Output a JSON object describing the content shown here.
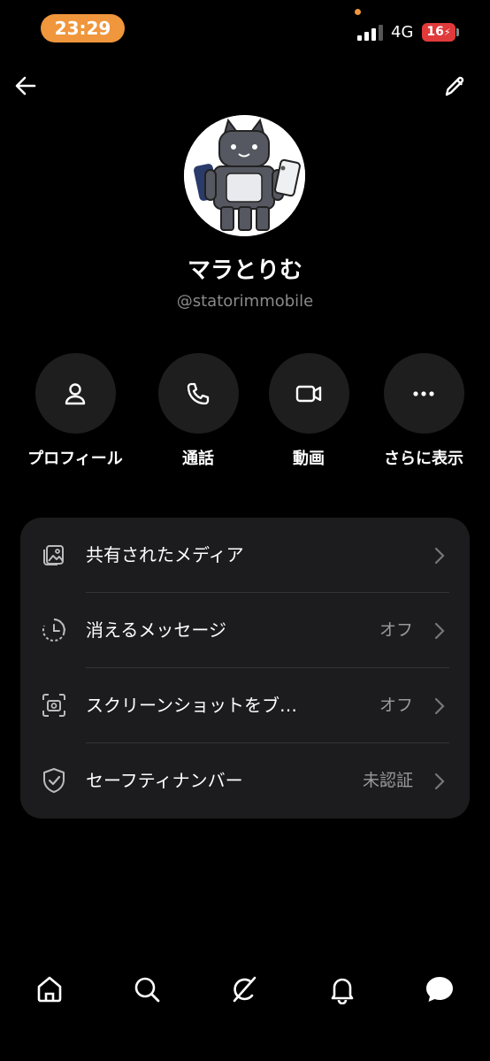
{
  "status_bar": {
    "time": "23:29",
    "network": "4G",
    "battery": "16",
    "accent_color": "#f0963c"
  },
  "header": {
    "back_icon": "arrow-left-icon",
    "edit_icon": "pencil-icon"
  },
  "profile": {
    "name": "マラとりむ",
    "handle": "@statorimmobile"
  },
  "actions": [
    {
      "label": "プロフィール",
      "icon": "person-icon"
    },
    {
      "label": "通話",
      "icon": "phone-icon"
    },
    {
      "label": "動画",
      "icon": "video-icon"
    },
    {
      "label": "さらに表示",
      "icon": "more-dots-icon"
    }
  ],
  "settings": [
    {
      "title": "共有されたメディア",
      "value": "",
      "icon": "media-icon"
    },
    {
      "title": "消えるメッセージ",
      "value": "オフ",
      "icon": "timer-icon"
    },
    {
      "title": "スクリーンショットをブ…",
      "value": "オフ",
      "icon": "screenshot-icon"
    },
    {
      "title": "セーフティナンバー",
      "value": "未認証",
      "icon": "shield-check-icon"
    }
  ],
  "bottom_nav": [
    {
      "icon": "home-icon"
    },
    {
      "icon": "search-icon"
    },
    {
      "icon": "grok-icon"
    },
    {
      "icon": "bell-icon"
    },
    {
      "icon": "messages-icon"
    }
  ]
}
